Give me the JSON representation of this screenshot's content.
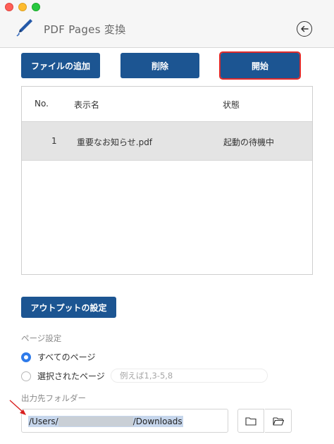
{
  "window": {
    "title": "PDF Pages 変換"
  },
  "toolbar": {
    "add_label": "ファイルの追加",
    "delete_label": "削除",
    "start_label": "開始"
  },
  "table": {
    "headers": {
      "no": "No.",
      "name": "表示名",
      "status": "状態"
    },
    "rows": [
      {
        "no": "1",
        "name": "重要なお知らせ.pdf",
        "status": "起動の待機中"
      }
    ]
  },
  "output": {
    "settings_label": "アウトプットの設定",
    "page_section_label": "ページ設定",
    "all_pages_label": "すべてのページ",
    "selected_pages_label": "選択されたページ",
    "range_placeholder": "例えば1,3-5,8",
    "folder_section_label": "出力先フォルダー",
    "path_prefix": "/Users/",
    "path_suffix": "/Downloads"
  },
  "colors": {
    "primary_button": "#1c5592",
    "highlight_outline": "#e02a2a",
    "radio_selected": "#2f7bea",
    "row_selected": "#e4e4e4"
  },
  "icons": {
    "app": "pen-icon",
    "back": "back-arrow-icon",
    "open_folder": "folder-icon",
    "browse_folder": "folder-open-icon",
    "annotation": "red-arrow-icon"
  }
}
